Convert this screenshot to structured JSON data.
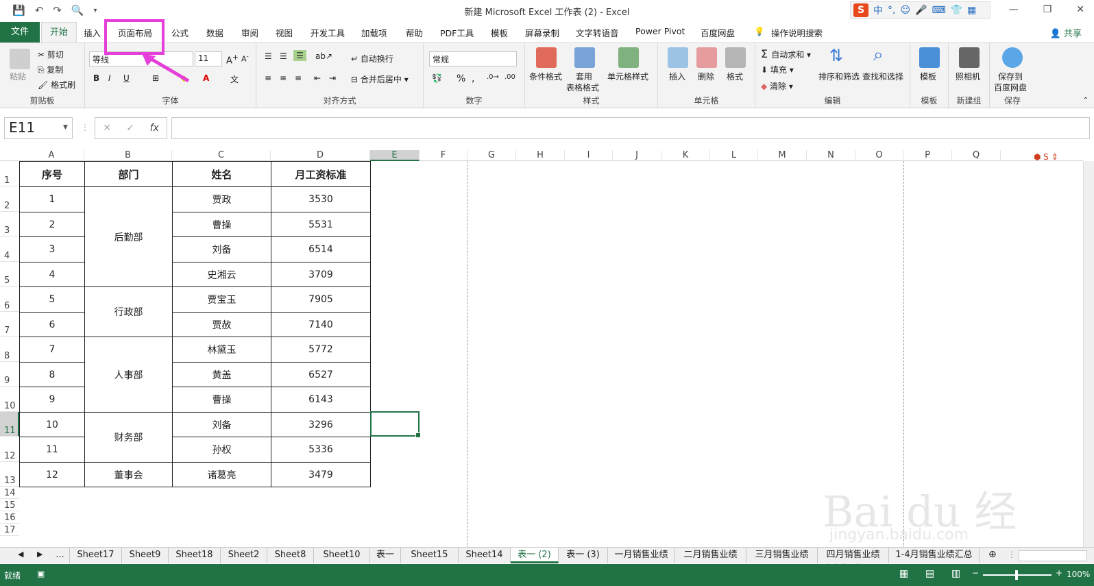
{
  "window": {
    "title": "新建 Microsoft Excel 工作表 (2)  -  Excel",
    "share_label": "共享"
  },
  "ime": {
    "logo": "S",
    "lang": "中",
    "punct": "°,"
  },
  "tabs": [
    "文件",
    "开始",
    "插入",
    "页面布局",
    "公式",
    "数据",
    "审阅",
    "视图",
    "开发工具",
    "加载项",
    "帮助",
    "PDF工具",
    "模板",
    "屏幕录制",
    "文字转语音",
    "Power Pivot",
    "百度网盘",
    "操作说明搜索"
  ],
  "ribbon": {
    "clipboard": {
      "paste": "粘贴",
      "cut": "剪切",
      "copy": "复制",
      "format_painter": "格式刷",
      "label": "剪贴板"
    },
    "font": {
      "name": "等线",
      "size": "11",
      "bold": "B",
      "italic": "I",
      "underline": "U",
      "label": "字体"
    },
    "alignment": {
      "wrap": "自动换行",
      "merge": "合并后居中",
      "label": "对齐方式"
    },
    "number": {
      "format": "常规",
      "percent": "%",
      "comma": ",",
      "label": "数字"
    },
    "styles": {
      "cond": "条件格式",
      "table1": "套用",
      "table2": "表格格式",
      "cell": "单元格样式",
      "label": "样式"
    },
    "cells": {
      "insert": "插入",
      "delete": "删除",
      "format": "格式",
      "label": "单元格"
    },
    "editing": {
      "autosum": "自动求和",
      "fill": "填充",
      "clear": "清除",
      "sort": "排序和筛选",
      "find": "查找和选择",
      "label": "编辑"
    },
    "template": {
      "btn": "模板",
      "label": "模板"
    },
    "camera": {
      "btn": "照相机",
      "label": "新建组"
    },
    "save": {
      "btn1": "保存到",
      "btn2": "百度网盘",
      "label": "保存"
    }
  },
  "formula_bar": {
    "name_box": "E11",
    "fx": "fx",
    "value": ""
  },
  "columns": [
    "A",
    "B",
    "C",
    "D",
    "E",
    "F",
    "G",
    "H",
    "I",
    "J",
    "K",
    "L",
    "M",
    "N",
    "O",
    "P",
    "Q"
  ],
  "rows": [
    "1",
    "2",
    "3",
    "4",
    "5",
    "6",
    "7",
    "8",
    "9",
    "10",
    "11",
    "12",
    "13",
    "14",
    "15",
    "16",
    "17"
  ],
  "table": {
    "headers": [
      "序号",
      "部门",
      "姓名",
      "月工资标准"
    ],
    "rows": [
      [
        "1",
        "后勤部",
        "贾政",
        "3530"
      ],
      [
        "2",
        "",
        "曹操",
        "5531"
      ],
      [
        "3",
        "",
        "刘备",
        "6514"
      ],
      [
        "4",
        "",
        "史湘云",
        "3709"
      ],
      [
        "5",
        "行政部",
        "贾宝玉",
        "7905"
      ],
      [
        "6",
        "",
        "贾赦",
        "7140"
      ],
      [
        "7",
        "人事部",
        "林黛玉",
        "5772"
      ],
      [
        "8",
        "",
        "黄盖",
        "6527"
      ],
      [
        "9",
        "",
        "曹操",
        "6143"
      ],
      [
        "10",
        "财务部",
        "刘备",
        "3296"
      ],
      [
        "11",
        "",
        "孙权",
        "5336"
      ],
      [
        "12",
        "董事会",
        "诸葛亮",
        "3479"
      ]
    ]
  },
  "sheets": [
    "...",
    "Sheet17",
    "Sheet9",
    "Sheet18",
    "Sheet2",
    "Sheet8",
    "Sheet10",
    "表一",
    "Sheet15",
    "Sheet14",
    "表一 (2)",
    "表一 (3)",
    "一月销售业绩",
    "二月销售业绩",
    "三月销售业绩",
    "四月销售业绩",
    "1-4月销售业绩汇总"
  ],
  "status": {
    "ready": "就绪",
    "zoom": "100%"
  },
  "watermark": {
    "main": "Bai du 经验",
    "sub": "jingyan.baidu.com"
  },
  "colors": {
    "accent": "#217346",
    "highlight": "#e63fd9"
  }
}
